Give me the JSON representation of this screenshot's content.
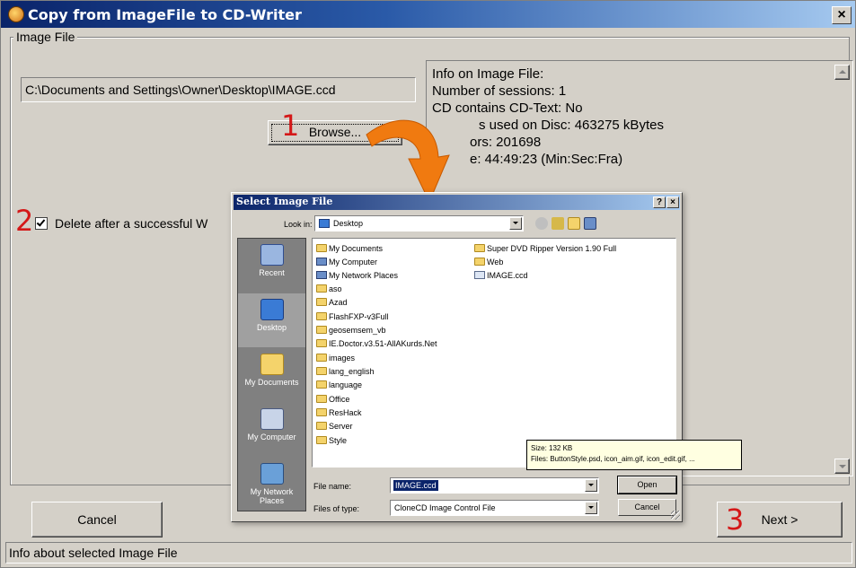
{
  "window": {
    "title": "Copy from ImageFile to CD-Writer",
    "close_glyph": "×"
  },
  "groupbox": {
    "legend": "Image File"
  },
  "image_path": "C:\\Documents and Settings\\Owner\\Desktop\\IMAGE.ccd",
  "browse_label": "Browse...",
  "info": {
    "lines": [
      "Info on Image File:",
      "Number of sessions: 1",
      "CD contains CD-Text: No",
      "s used on Disc: 463275 kBytes",
      "ors: 201698",
      "e: 44:49:23 (Min:Sec:Fra)"
    ]
  },
  "delete_checkbox": {
    "label": "Delete after a successful W",
    "checked": true
  },
  "cancel_label": "Cancel",
  "next_label": "Next >",
  "status_text": "Info about selected Image File",
  "steps": [
    "1",
    "2",
    "3"
  ],
  "dialog": {
    "title": "Select Image File",
    "help_glyph": "?",
    "close_glyph": "×",
    "look_in_label": "Look in:",
    "look_in_value": "Desktop",
    "places": [
      {
        "label": "Recent",
        "icon": "recent-icon"
      },
      {
        "label": "Desktop",
        "icon": "desktop-icon"
      },
      {
        "label": "My Documents",
        "icon": "my-documents-icon"
      },
      {
        "label": "My Computer",
        "icon": "my-computer-icon"
      },
      {
        "label": "My Network Places",
        "icon": "network-places-icon"
      }
    ],
    "files_col1": [
      {
        "name": "My Documents",
        "icon": "folder"
      },
      {
        "name": "My Computer",
        "icon": "computer"
      },
      {
        "name": "My Network Places",
        "icon": "computer"
      },
      {
        "name": "aso",
        "icon": "folder"
      },
      {
        "name": "Azad",
        "icon": "folder"
      },
      {
        "name": "FlashFXP-v3Full",
        "icon": "folder"
      },
      {
        "name": "geosemsem_vb",
        "icon": "folder"
      },
      {
        "name": "IE.Doctor.v3.51-AllAKurds.Net",
        "icon": "folder"
      },
      {
        "name": "images",
        "icon": "folder"
      },
      {
        "name": "lang_english",
        "icon": "folder"
      },
      {
        "name": "language",
        "icon": "folder"
      },
      {
        "name": "Office",
        "icon": "folder"
      },
      {
        "name": "ResHack",
        "icon": "folder"
      },
      {
        "name": "Server",
        "icon": "folder"
      },
      {
        "name": "Style",
        "icon": "folder"
      }
    ],
    "files_col2": [
      {
        "name": "Super DVD Ripper Version 1.90 Full",
        "icon": "folder"
      },
      {
        "name": "Web",
        "icon": "folder"
      },
      {
        "name": "IMAGE.ccd",
        "icon": "document"
      }
    ],
    "tooltip": {
      "line1": "Size: 132 KB",
      "line2": "Files: ButtonStyle.psd, icon_aim.gif, icon_edit.gif, ..."
    },
    "file_name_label": "File name:",
    "file_name_value": "IMAGE.ccd",
    "file_type_label": "Files of type:",
    "file_type_value": "CloneCD Image Control File",
    "open_label": "Open",
    "cancel_label": "Cancel"
  },
  "colors": {
    "accent_title": "#0a246a",
    "step_red": "#d41818",
    "arrow_orange": "#f07a10"
  }
}
